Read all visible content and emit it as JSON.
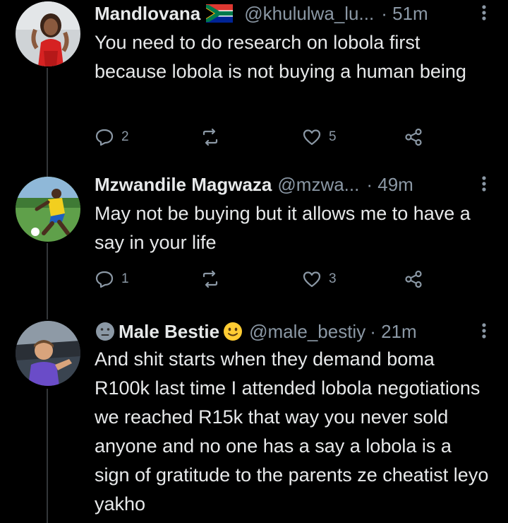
{
  "tweets": [
    {
      "name": "Mandlovana",
      "handle": "@khululwa_lu...",
      "time": "· 51m",
      "text": "You need to do research on lobola first because lobola is not buying a human being",
      "replies": "2",
      "retweets": "",
      "likes": "5",
      "name_suffix_icon": "south-africa-flag-icon"
    },
    {
      "name": "Mzwandile Magwaza",
      "handle": "@mzwa...",
      "time": "· 49m",
      "text": "May not be buying but it allows me to have a say in your life",
      "replies": "1",
      "retweets": "",
      "likes": "3"
    },
    {
      "name": "Male Bestie",
      "handle": "@male_bestiy",
      "time": "· 21m",
      "text": "And shit starts when they demand boma R100k last time I attended lobola negotiations we reached R15k that way you never sold anyone and no one has a say a lobola is a sign of gratitude to the parents ze cheatist leyo yakho",
      "name_prefix_icon": "neutral-face-emoji-icon",
      "name_suffix_icon": "smiling-face-emoji-icon"
    }
  ],
  "colors": {
    "background": "#000000",
    "text": "#e7e9ea",
    "secondary": "#8b98a5",
    "thread_line": "#333639"
  }
}
